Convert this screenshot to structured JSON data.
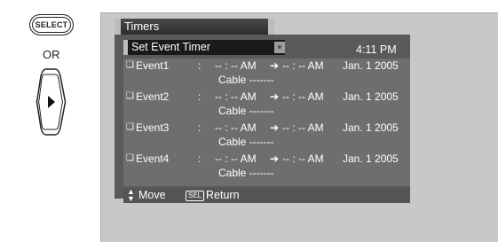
{
  "remote": {
    "select_label": "SELECT",
    "or_label": "OR"
  },
  "menu": {
    "title": "Timers",
    "submenu": "Set Event Timer",
    "clock": "4:11 PM"
  },
  "events": [
    {
      "name": "Event1",
      "colon": ":",
      "start": "-- : -- AM",
      "end": "-- : -- AM",
      "date": "Jan. 1 2005",
      "channel": "Cable  -------"
    },
    {
      "name": "Event2",
      "colon": ":",
      "start": "-- : -- AM",
      "end": "-- : -- AM",
      "date": "Jan. 1 2005",
      "channel": "Cable  -------"
    },
    {
      "name": "Event3",
      "colon": ":",
      "start": "-- : -- AM",
      "end": "-- : -- AM",
      "date": "Jan. 1 2005",
      "channel": "Cable  -------"
    },
    {
      "name": "Event4",
      "colon": ":",
      "start": "-- : -- AM",
      "end": "-- : -- AM",
      "date": "Jan. 1 2005",
      "channel": "Cable  -------"
    }
  ],
  "footer": {
    "move_label": "Move",
    "sel_key": "SEL",
    "return_label": "Return"
  }
}
